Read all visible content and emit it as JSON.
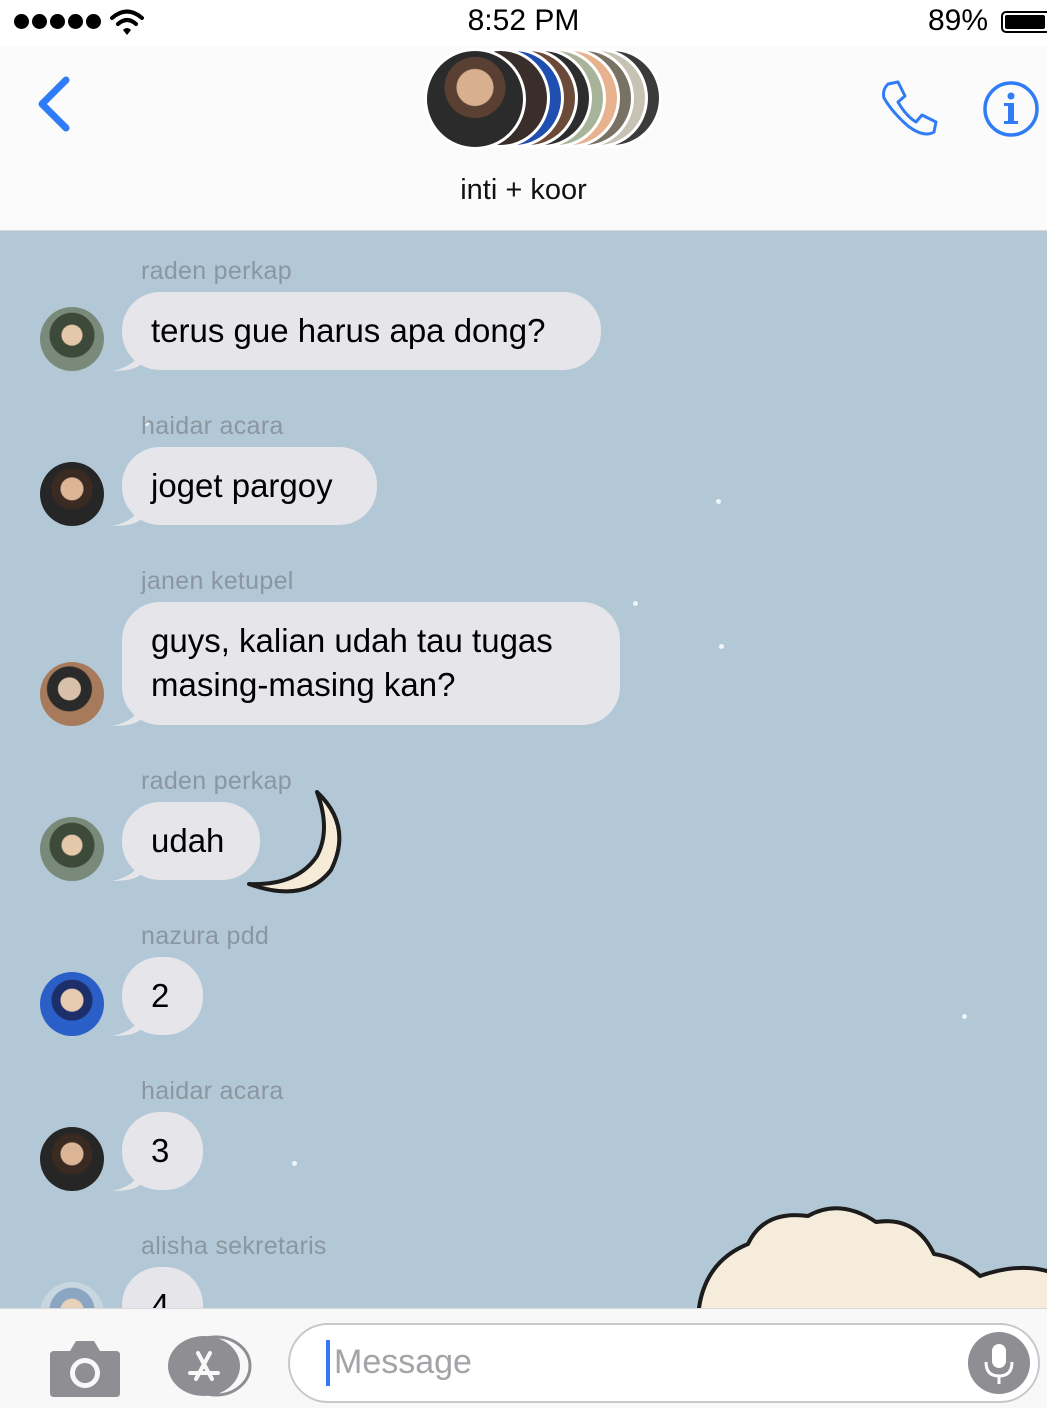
{
  "status_bar": {
    "time": "8:52 PM",
    "battery": "89%",
    "battery_level": 0.89
  },
  "header": {
    "title": "inti + koor",
    "back_icon": "chevron-left-icon",
    "call_icon": "phone-icon",
    "info_icon": "info-icon"
  },
  "messages": [
    {
      "sender": "raden perkap",
      "text": "terus gue harus apa dong?"
    },
    {
      "sender": "haidar acara",
      "text": "joget pargoy"
    },
    {
      "sender": "janen ketupel",
      "text": "guys, kalian udah tau tugas masing-masing kan?"
    },
    {
      "sender": "raden perkap",
      "text": "udah"
    },
    {
      "sender": "nazura pdd",
      "text": "2"
    },
    {
      "sender": "haidar acara",
      "text": "3"
    },
    {
      "sender": "alisha sekretaris",
      "text": "4"
    }
  ],
  "input": {
    "placeholder": "Message",
    "camera_icon": "camera-icon",
    "apps_icon": "app-store-icon",
    "mic_icon": "microphone-icon"
  },
  "colors": {
    "accent": "#3478f6",
    "bubble": "#e6e6ea",
    "chat_background": "#b3c8d6"
  }
}
